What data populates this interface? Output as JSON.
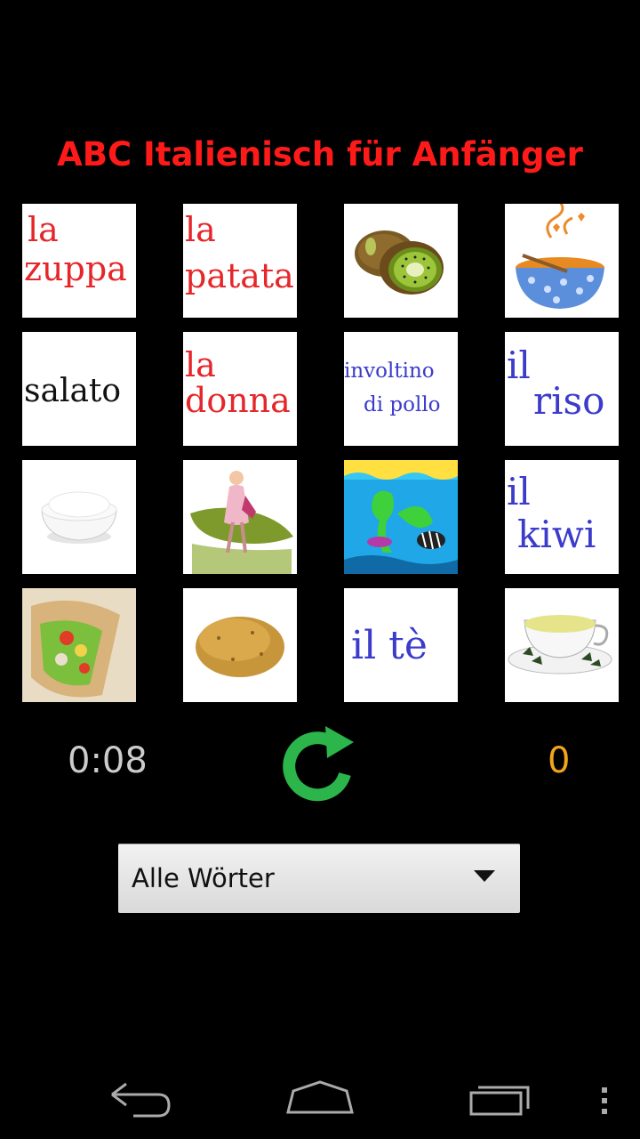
{
  "app": {
    "title": "ABC Italienisch für Anfänger"
  },
  "cards": {
    "r0c0": {
      "lines": [
        "la",
        "zuppa"
      ],
      "color": "#e5262a"
    },
    "r0c1": {
      "lines": [
        "la",
        "patata"
      ],
      "color": "#e5262a"
    },
    "r0c2": {
      "image": "kiwi-fruit-image"
    },
    "r0c3": {
      "image": "soup-bowl-image"
    },
    "r1c0": {
      "lines": [
        "salato"
      ],
      "color": "#111111"
    },
    "r1c1": {
      "lines": [
        "la",
        "donna"
      ],
      "color": "#e5262a"
    },
    "r1c2": {
      "lines": [
        "involtino",
        "di pollo"
      ],
      "color": "#3b3bcc"
    },
    "r1c3": {
      "lines": [
        "il",
        "riso"
      ],
      "color": "#3b3bcc"
    },
    "r2c0": {
      "image": "rice-bowl-image"
    },
    "r2c1": {
      "image": "woman-walking-image"
    },
    "r2c2": {
      "image": "aquarium-fish-image"
    },
    "r2c3": {
      "lines": [
        "il",
        "kiwi"
      ],
      "color": "#3b3bcc"
    },
    "r3c0": {
      "image": "chicken-wrap-image"
    },
    "r3c1": {
      "image": "potato-image"
    },
    "r3c2": {
      "lines": [
        "il tè"
      ],
      "color": "#3b3bcc"
    },
    "r3c3": {
      "image": "tea-cup-image"
    }
  },
  "status": {
    "timer": "0:08",
    "score": "0"
  },
  "filter": {
    "selected": "Alle Wörter"
  },
  "colors": {
    "title": "#ff1a1a",
    "score": "#f3a41c",
    "refresh": "#2bb54a"
  },
  "navbar": {
    "icons": [
      "back-icon",
      "home-icon",
      "recent-apps-icon",
      "overflow-menu-icon"
    ]
  }
}
